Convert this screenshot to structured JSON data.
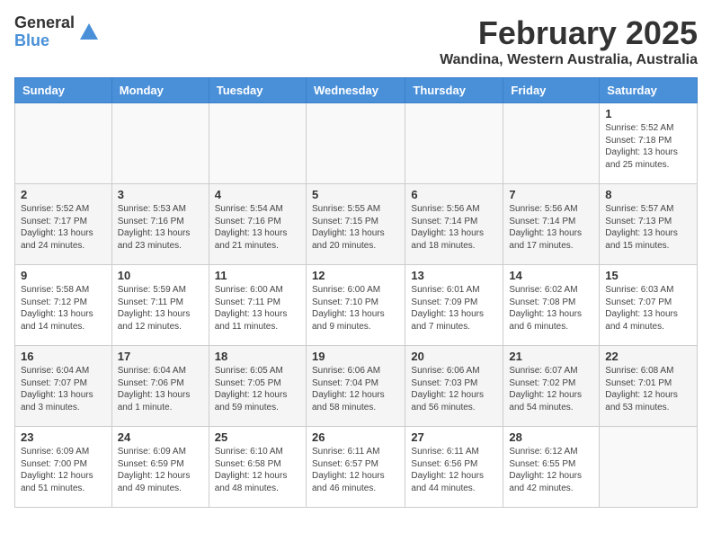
{
  "header": {
    "logo_general": "General",
    "logo_blue": "Blue",
    "month_title": "February 2025",
    "location": "Wandina, Western Australia, Australia"
  },
  "days_of_week": [
    "Sunday",
    "Monday",
    "Tuesday",
    "Wednesday",
    "Thursday",
    "Friday",
    "Saturday"
  ],
  "weeks": [
    [
      {
        "day": "",
        "info": ""
      },
      {
        "day": "",
        "info": ""
      },
      {
        "day": "",
        "info": ""
      },
      {
        "day": "",
        "info": ""
      },
      {
        "day": "",
        "info": ""
      },
      {
        "day": "",
        "info": ""
      },
      {
        "day": "1",
        "info": "Sunrise: 5:52 AM\nSunset: 7:18 PM\nDaylight: 13 hours\nand 25 minutes."
      }
    ],
    [
      {
        "day": "2",
        "info": "Sunrise: 5:52 AM\nSunset: 7:17 PM\nDaylight: 13 hours\nand 24 minutes."
      },
      {
        "day": "3",
        "info": "Sunrise: 5:53 AM\nSunset: 7:16 PM\nDaylight: 13 hours\nand 23 minutes."
      },
      {
        "day": "4",
        "info": "Sunrise: 5:54 AM\nSunset: 7:16 PM\nDaylight: 13 hours\nand 21 minutes."
      },
      {
        "day": "5",
        "info": "Sunrise: 5:55 AM\nSunset: 7:15 PM\nDaylight: 13 hours\nand 20 minutes."
      },
      {
        "day": "6",
        "info": "Sunrise: 5:56 AM\nSunset: 7:14 PM\nDaylight: 13 hours\nand 18 minutes."
      },
      {
        "day": "7",
        "info": "Sunrise: 5:56 AM\nSunset: 7:14 PM\nDaylight: 13 hours\nand 17 minutes."
      },
      {
        "day": "8",
        "info": "Sunrise: 5:57 AM\nSunset: 7:13 PM\nDaylight: 13 hours\nand 15 minutes."
      }
    ],
    [
      {
        "day": "9",
        "info": "Sunrise: 5:58 AM\nSunset: 7:12 PM\nDaylight: 13 hours\nand 14 minutes."
      },
      {
        "day": "10",
        "info": "Sunrise: 5:59 AM\nSunset: 7:11 PM\nDaylight: 13 hours\nand 12 minutes."
      },
      {
        "day": "11",
        "info": "Sunrise: 6:00 AM\nSunset: 7:11 PM\nDaylight: 13 hours\nand 11 minutes."
      },
      {
        "day": "12",
        "info": "Sunrise: 6:00 AM\nSunset: 7:10 PM\nDaylight: 13 hours\nand 9 minutes."
      },
      {
        "day": "13",
        "info": "Sunrise: 6:01 AM\nSunset: 7:09 PM\nDaylight: 13 hours\nand 7 minutes."
      },
      {
        "day": "14",
        "info": "Sunrise: 6:02 AM\nSunset: 7:08 PM\nDaylight: 13 hours\nand 6 minutes."
      },
      {
        "day": "15",
        "info": "Sunrise: 6:03 AM\nSunset: 7:07 PM\nDaylight: 13 hours\nand 4 minutes."
      }
    ],
    [
      {
        "day": "16",
        "info": "Sunrise: 6:04 AM\nSunset: 7:07 PM\nDaylight: 13 hours\nand 3 minutes."
      },
      {
        "day": "17",
        "info": "Sunrise: 6:04 AM\nSunset: 7:06 PM\nDaylight: 13 hours\nand 1 minute."
      },
      {
        "day": "18",
        "info": "Sunrise: 6:05 AM\nSunset: 7:05 PM\nDaylight: 12 hours\nand 59 minutes."
      },
      {
        "day": "19",
        "info": "Sunrise: 6:06 AM\nSunset: 7:04 PM\nDaylight: 12 hours\nand 58 minutes."
      },
      {
        "day": "20",
        "info": "Sunrise: 6:06 AM\nSunset: 7:03 PM\nDaylight: 12 hours\nand 56 minutes."
      },
      {
        "day": "21",
        "info": "Sunrise: 6:07 AM\nSunset: 7:02 PM\nDaylight: 12 hours\nand 54 minutes."
      },
      {
        "day": "22",
        "info": "Sunrise: 6:08 AM\nSunset: 7:01 PM\nDaylight: 12 hours\nand 53 minutes."
      }
    ],
    [
      {
        "day": "23",
        "info": "Sunrise: 6:09 AM\nSunset: 7:00 PM\nDaylight: 12 hours\nand 51 minutes."
      },
      {
        "day": "24",
        "info": "Sunrise: 6:09 AM\nSunset: 6:59 PM\nDaylight: 12 hours\nand 49 minutes."
      },
      {
        "day": "25",
        "info": "Sunrise: 6:10 AM\nSunset: 6:58 PM\nDaylight: 12 hours\nand 48 minutes."
      },
      {
        "day": "26",
        "info": "Sunrise: 6:11 AM\nSunset: 6:57 PM\nDaylight: 12 hours\nand 46 minutes."
      },
      {
        "day": "27",
        "info": "Sunrise: 6:11 AM\nSunset: 6:56 PM\nDaylight: 12 hours\nand 44 minutes."
      },
      {
        "day": "28",
        "info": "Sunrise: 6:12 AM\nSunset: 6:55 PM\nDaylight: 12 hours\nand 42 minutes."
      },
      {
        "day": "",
        "info": ""
      }
    ]
  ]
}
